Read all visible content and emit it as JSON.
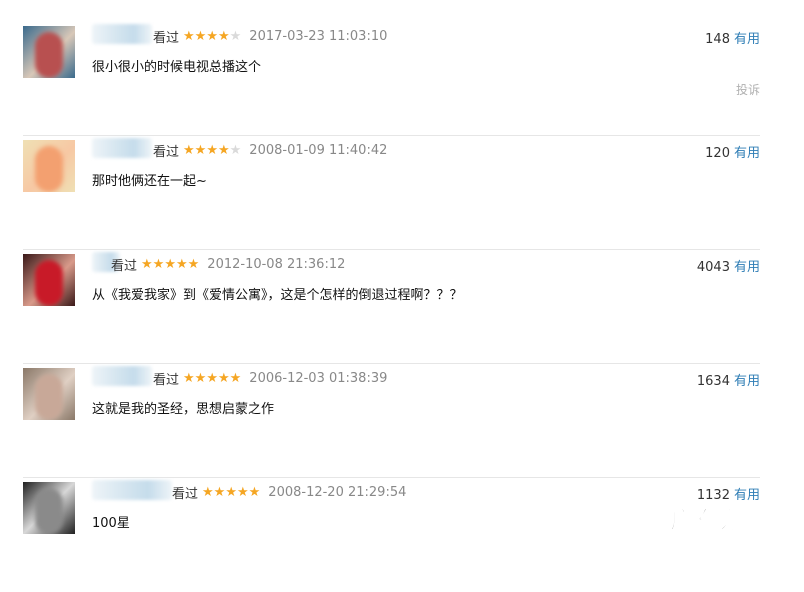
{
  "comments": [
    {
      "seen": "看过",
      "rating": 4,
      "date": "2017-03-23 11:03:10",
      "votes": "148",
      "useful": "有用",
      "text": "很小很小的时候电视总播这个",
      "report": "投诉",
      "avatar_colors": [
        "#3a6a8c",
        "#b85050",
        "#d8c8b8"
      ]
    },
    {
      "seen": "看过",
      "rating": 4,
      "date": "2008-01-09 11:40:42",
      "votes": "120",
      "useful": "有用",
      "text": "那时他俩还在一起~",
      "report": "",
      "avatar_colors": [
        "#efe0b4",
        "#f3a070",
        "#f7c8a4"
      ]
    },
    {
      "seen": "看过",
      "rating": 5,
      "date": "2012-10-08 21:36:12",
      "votes": "4043",
      "useful": "有用",
      "text": "从《我爱我家》到《爱情公寓》，这是个怎样的倒退过程啊？？？",
      "report": "",
      "avatar_colors": [
        "#3a1818",
        "#c81a28",
        "#d89a8a"
      ]
    },
    {
      "seen": "看过",
      "rating": 5,
      "date": "2006-12-03 01:38:39",
      "votes": "1634",
      "useful": "有用",
      "text": "这就是我的圣经，思想启蒙之作",
      "report": "",
      "avatar_colors": [
        "#8a7868",
        "#c8a898",
        "#e0d0c4"
      ]
    },
    {
      "seen": "看过",
      "rating": 5,
      "date": "2008-12-20 21:29:54",
      "votes": "1132",
      "useful": "有用",
      "text": "100星",
      "report": "",
      "avatar_colors": [
        "#202020",
        "#d8d8d8",
        "#8a8a8a"
      ]
    }
  ],
  "watermark": "广东龙网"
}
